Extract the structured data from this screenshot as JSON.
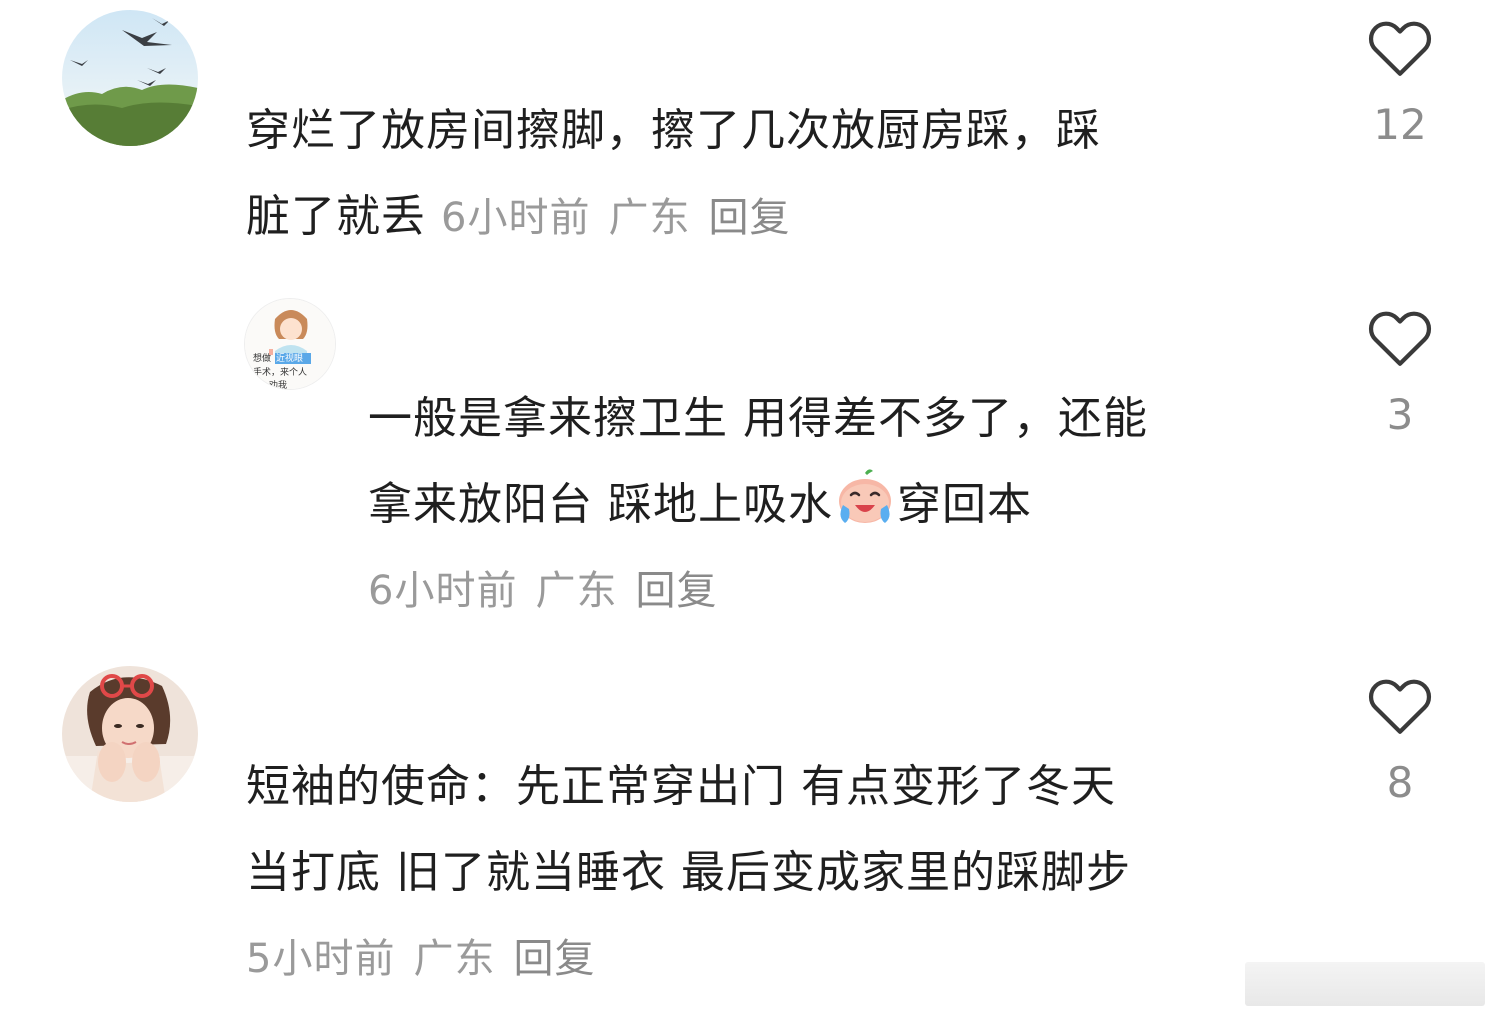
{
  "comments": [
    {
      "avatar_desc": "birds-sky-avatar",
      "text_line1": "穿烂了放房间擦脚，擦了几次放厨房踩，踩",
      "text_line2": "脏了就丢",
      "time": "6小时前",
      "location": "广东",
      "reply_label": "回复",
      "like_count": "12"
    },
    {
      "avatar_desc": "cartoon-girl-avatar",
      "avatar_caption_1": "想做",
      "avatar_caption_highlight": "近视眼",
      "avatar_caption_2": "手术，来个人",
      "avatar_caption_3": "劝我",
      "text_line1": "一般是拿来擦卫生 用得差不多了，还能",
      "text_line2_a": "拿来放阳台 踩地上吸水",
      "text_line2_b": "穿回本",
      "time": "6小时前",
      "location": "广东",
      "reply_label": "回复",
      "like_count": "3"
    },
    {
      "avatar_desc": "woman-photo-avatar",
      "text_line1": "短袖的使命：先正常穿出门 有点变形了冬天",
      "text_line2": "当打底 旧了就当睡衣 最后变成家里的踩脚步",
      "time": "5小时前",
      "location": "广东",
      "reply_label": "回复",
      "like_count": "8"
    }
  ],
  "icons": {
    "like": "heart-outline-icon",
    "emoji": "crying-laughing-emoji"
  },
  "colors": {
    "text": "#1f1f1f",
    "meta": "#9a9a9a",
    "icon": "#3a3a3a"
  }
}
